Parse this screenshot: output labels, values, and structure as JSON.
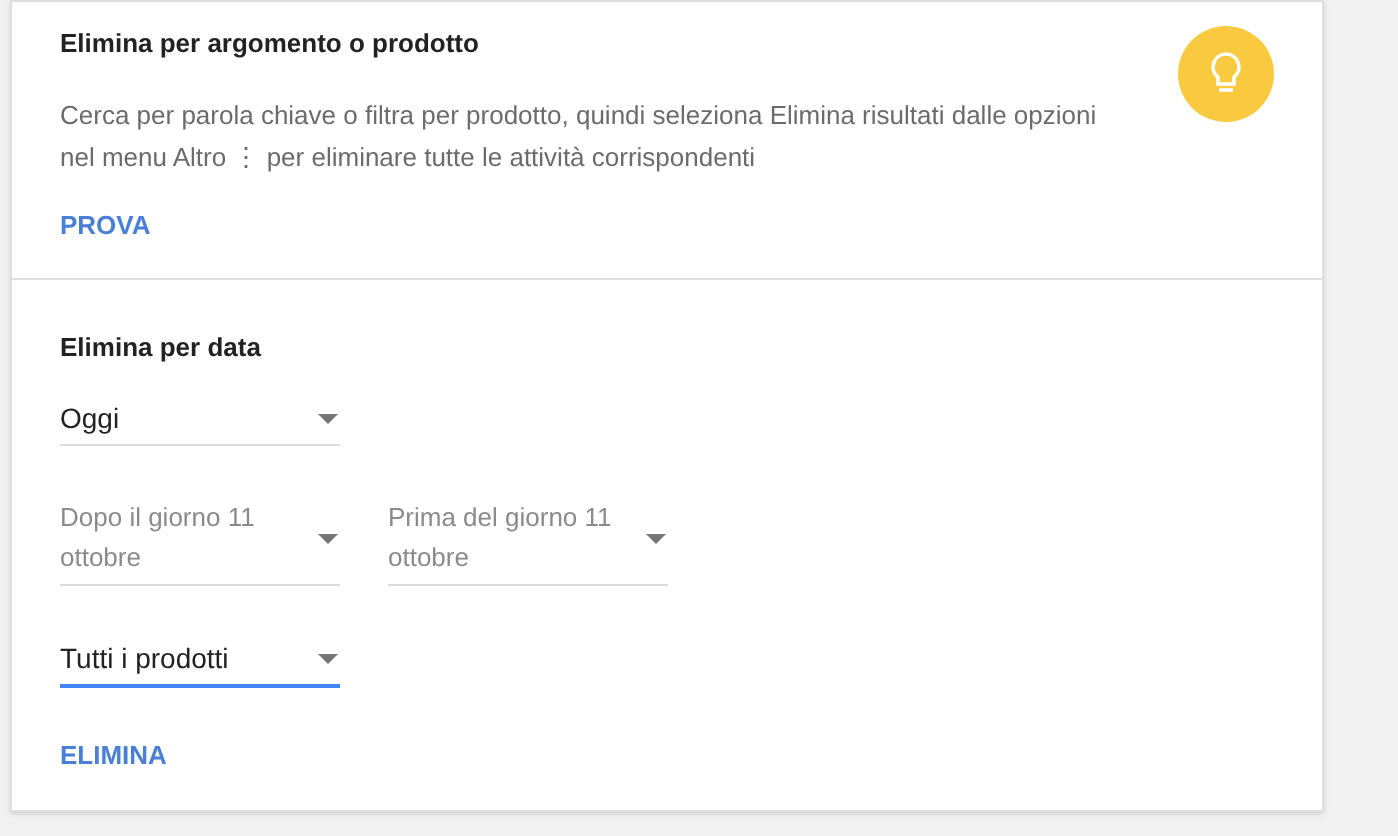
{
  "topic_section": {
    "title": "Elimina per argomento o prodotto",
    "description": "Cerca per parola chiave o filtra per prodotto, quindi seleziona Elimina risultati dalle opzioni nel menu Altro ⋮ per eliminare tutte le attività corrispondenti",
    "action": "PROVA"
  },
  "date_section": {
    "title": "Elimina per data",
    "rows": [
      [
        {
          "value": "Oggi",
          "disabled": false,
          "focused": false
        }
      ],
      [
        {
          "value": "Dopo il giorno 11 ottobre",
          "disabled": true,
          "focused": false
        },
        {
          "value": "Prima del giorno 11 ottobre",
          "disabled": true,
          "focused": false
        }
      ],
      [
        {
          "value": "Tutti i prodotti",
          "disabled": false,
          "focused": true
        }
      ]
    ],
    "action": "ELIMINA"
  }
}
